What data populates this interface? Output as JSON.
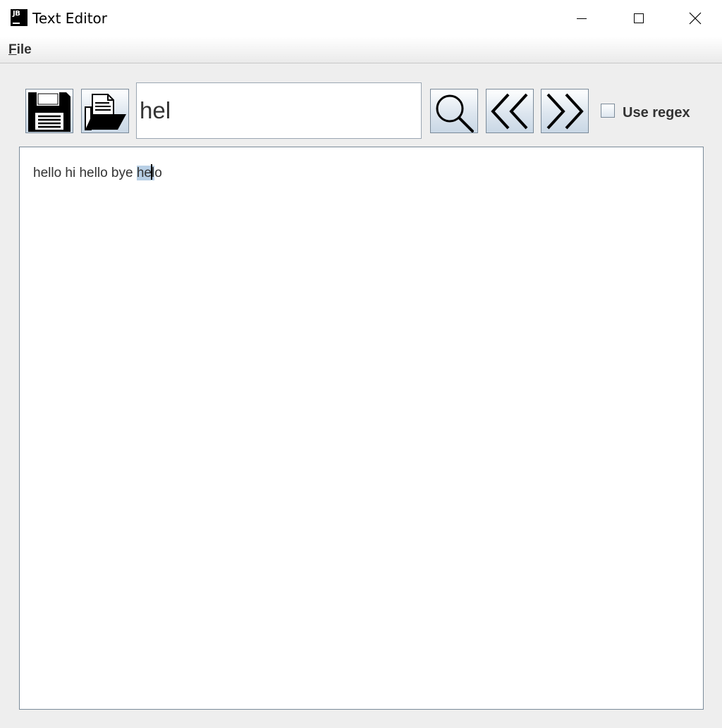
{
  "window": {
    "title": "Text Editor",
    "logo_text": "JB"
  },
  "menu": {
    "items": [
      {
        "label": "File",
        "mnemonic": "F",
        "rest": "ile"
      }
    ]
  },
  "toolbar": {
    "buttons": [
      {
        "id": "save",
        "icon": "floppy-disk-icon"
      },
      {
        "id": "open",
        "icon": "open-folder-icon"
      },
      {
        "id": "search",
        "icon": "magnifier-icon"
      },
      {
        "id": "previous",
        "icon": "double-chevron-left-icon"
      },
      {
        "id": "next",
        "icon": "double-chevron-right-icon"
      }
    ],
    "search_value": "hel",
    "use_regex": {
      "label": "Use regex",
      "checked": false
    }
  },
  "editor": {
    "text_before": "hello hi hello bye ",
    "match_before_caret": "he",
    "match_after_caret": "l",
    "text_after": "o"
  },
  "colors": {
    "selection_highlight": "#b8cfe5",
    "button_border": "#7a8a99"
  }
}
